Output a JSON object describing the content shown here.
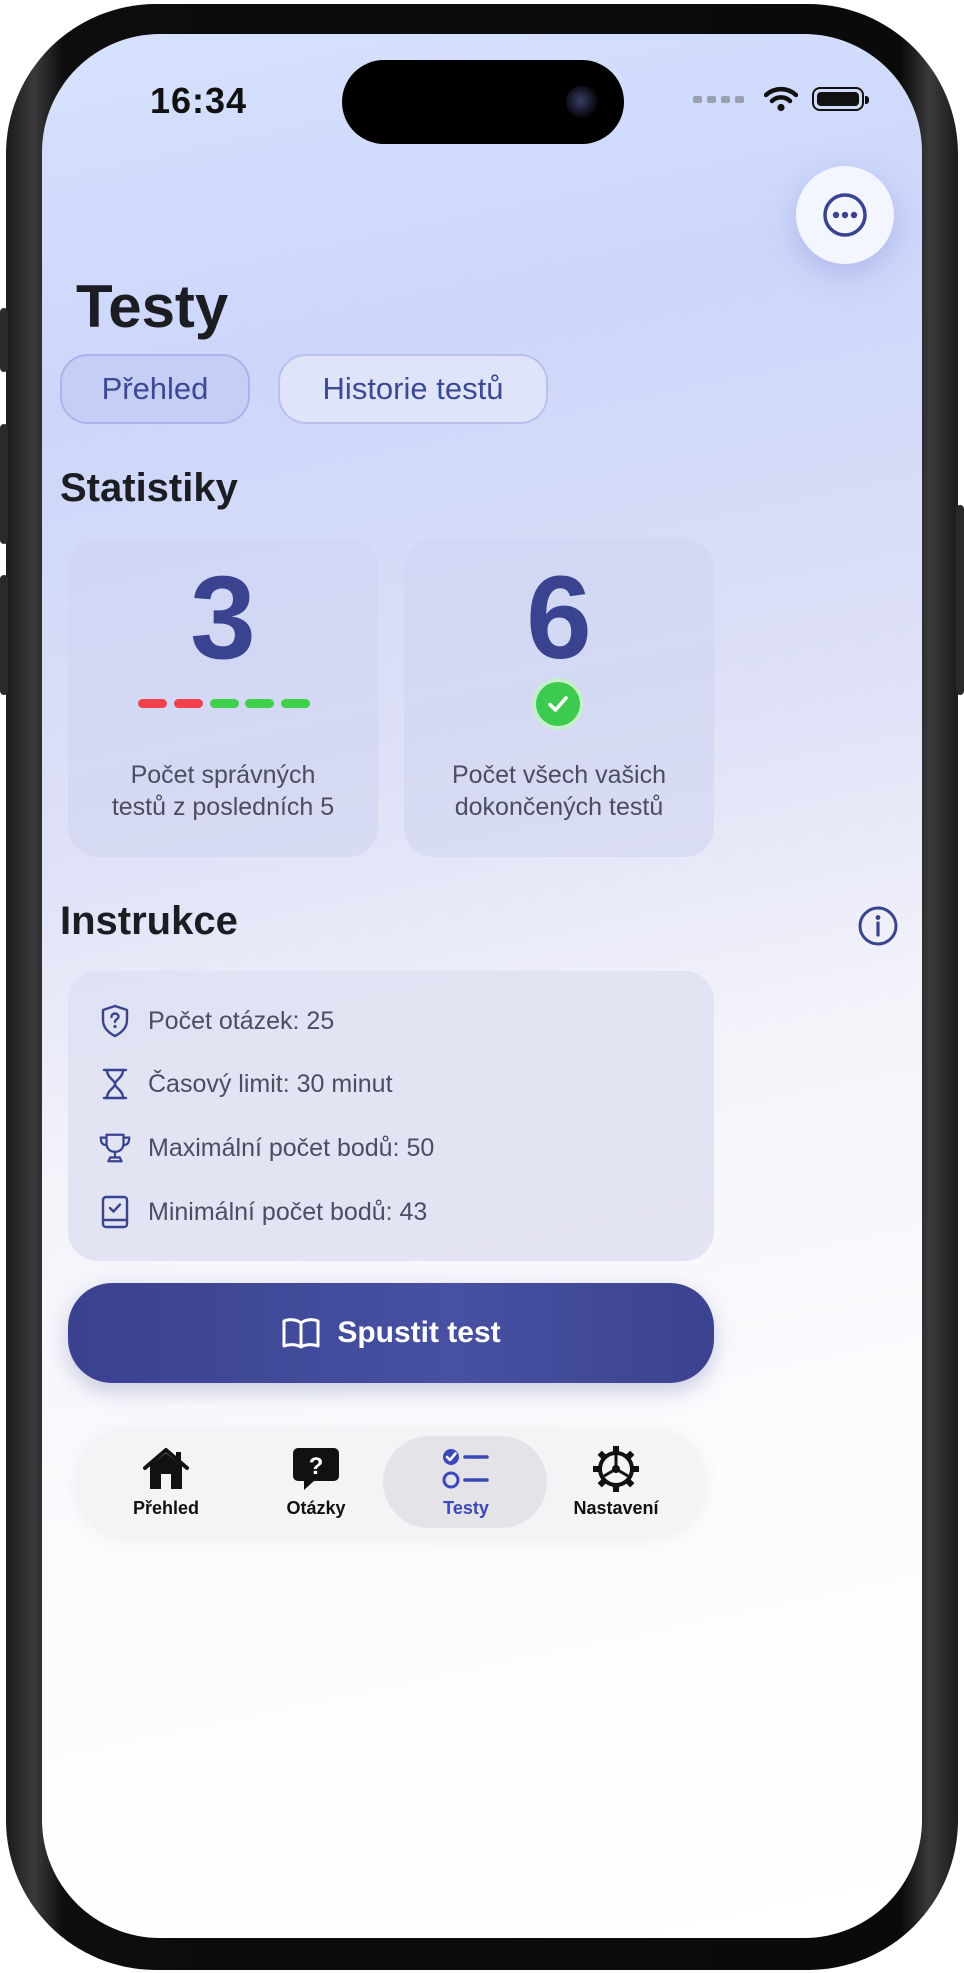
{
  "status_bar": {
    "time": "16:34"
  },
  "header": {
    "title": "Testy",
    "more_icon": "ellipsis-circle-icon"
  },
  "segments": [
    {
      "label": "Přehled",
      "active": true
    },
    {
      "label": "Historie testů",
      "active": false
    }
  ],
  "statistics": {
    "title": "Statistiky",
    "cards": [
      {
        "value": "3",
        "label_line1": "Počet správných",
        "label_line2": "testů z posledních 5",
        "results": [
          "wrong",
          "wrong",
          "correct",
          "correct",
          "correct"
        ]
      },
      {
        "value": "6",
        "label_line1": "Počet všech vašich",
        "label_line2": "dokončených testů",
        "icon": "checkmark-circle-icon"
      }
    ]
  },
  "instructions": {
    "title": "Instrukce",
    "info_icon": "info-circle-icon",
    "items": [
      {
        "icon": "shield-question-icon",
        "text": "Počet otázek: 25"
      },
      {
        "icon": "hourglass-icon",
        "text": "Časový limit: 30 minut"
      },
      {
        "icon": "trophy-icon",
        "text": "Maximální počet bodů: 50"
      },
      {
        "icon": "checklist-book-icon",
        "text": "Minimální počet bodů: 43"
      }
    ]
  },
  "start_button": {
    "label": "Spustit test",
    "icon": "open-book-icon"
  },
  "tab_bar": [
    {
      "label": "Přehled",
      "icon": "house-icon",
      "active": false
    },
    {
      "label": "Otázky",
      "icon": "question-bubble-icon",
      "active": false
    },
    {
      "label": "Testy",
      "icon": "list-checklist-icon",
      "active": true
    },
    {
      "label": "Nastavení",
      "icon": "gear-icon",
      "active": false
    }
  ],
  "colors": {
    "accent": "#3a4390",
    "tab_active": "#3b49b8",
    "wrong": "#f2414a",
    "correct": "#3fd14c",
    "text_dark": "#1c1d22",
    "text_muted": "#4a4e60"
  }
}
